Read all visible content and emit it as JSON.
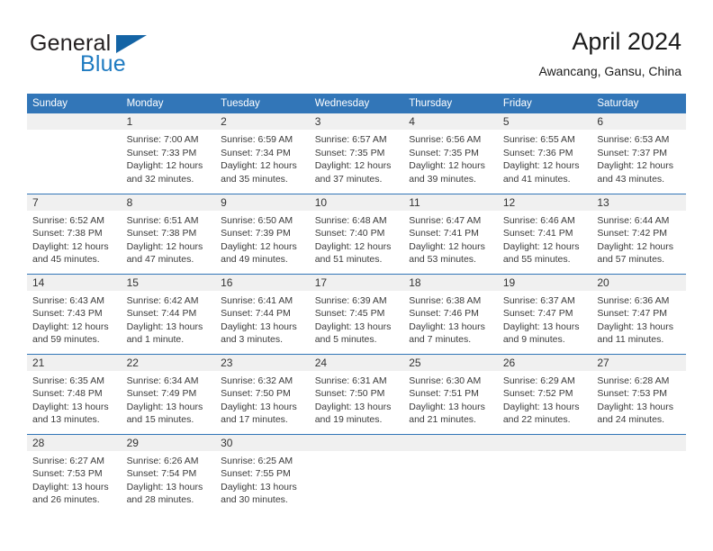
{
  "brand": {
    "name_part1": "General",
    "name_part2": "Blue",
    "flag_icon": "triangle-flag-icon"
  },
  "header": {
    "title": "April 2024",
    "subtitle": "Awancang, Gansu, China"
  },
  "colors": {
    "header_blue": "#3276b8",
    "brand_blue": "#1f7bc1",
    "flag_blue": "#1464a5",
    "daynum_band": "#f0f0f0",
    "body_text": "#3a3a3a"
  },
  "weekdays": [
    "Sunday",
    "Monday",
    "Tuesday",
    "Wednesday",
    "Thursday",
    "Friday",
    "Saturday"
  ],
  "weeks": [
    [
      {
        "day": "",
        "lines": []
      },
      {
        "day": "1",
        "lines": [
          "Sunrise: 7:00 AM",
          "Sunset: 7:33 PM",
          "Daylight: 12 hours",
          "and 32 minutes."
        ]
      },
      {
        "day": "2",
        "lines": [
          "Sunrise: 6:59 AM",
          "Sunset: 7:34 PM",
          "Daylight: 12 hours",
          "and 35 minutes."
        ]
      },
      {
        "day": "3",
        "lines": [
          "Sunrise: 6:57 AM",
          "Sunset: 7:35 PM",
          "Daylight: 12 hours",
          "and 37 minutes."
        ]
      },
      {
        "day": "4",
        "lines": [
          "Sunrise: 6:56 AM",
          "Sunset: 7:35 PM",
          "Daylight: 12 hours",
          "and 39 minutes."
        ]
      },
      {
        "day": "5",
        "lines": [
          "Sunrise: 6:55 AM",
          "Sunset: 7:36 PM",
          "Daylight: 12 hours",
          "and 41 minutes."
        ]
      },
      {
        "day": "6",
        "lines": [
          "Sunrise: 6:53 AM",
          "Sunset: 7:37 PM",
          "Daylight: 12 hours",
          "and 43 minutes."
        ]
      }
    ],
    [
      {
        "day": "7",
        "lines": [
          "Sunrise: 6:52 AM",
          "Sunset: 7:38 PM",
          "Daylight: 12 hours",
          "and 45 minutes."
        ]
      },
      {
        "day": "8",
        "lines": [
          "Sunrise: 6:51 AM",
          "Sunset: 7:38 PM",
          "Daylight: 12 hours",
          "and 47 minutes."
        ]
      },
      {
        "day": "9",
        "lines": [
          "Sunrise: 6:50 AM",
          "Sunset: 7:39 PM",
          "Daylight: 12 hours",
          "and 49 minutes."
        ]
      },
      {
        "day": "10",
        "lines": [
          "Sunrise: 6:48 AM",
          "Sunset: 7:40 PM",
          "Daylight: 12 hours",
          "and 51 minutes."
        ]
      },
      {
        "day": "11",
        "lines": [
          "Sunrise: 6:47 AM",
          "Sunset: 7:41 PM",
          "Daylight: 12 hours",
          "and 53 minutes."
        ]
      },
      {
        "day": "12",
        "lines": [
          "Sunrise: 6:46 AM",
          "Sunset: 7:41 PM",
          "Daylight: 12 hours",
          "and 55 minutes."
        ]
      },
      {
        "day": "13",
        "lines": [
          "Sunrise: 6:44 AM",
          "Sunset: 7:42 PM",
          "Daylight: 12 hours",
          "and 57 minutes."
        ]
      }
    ],
    [
      {
        "day": "14",
        "lines": [
          "Sunrise: 6:43 AM",
          "Sunset: 7:43 PM",
          "Daylight: 12 hours",
          "and 59 minutes."
        ]
      },
      {
        "day": "15",
        "lines": [
          "Sunrise: 6:42 AM",
          "Sunset: 7:44 PM",
          "Daylight: 13 hours",
          "and 1 minute."
        ]
      },
      {
        "day": "16",
        "lines": [
          "Sunrise: 6:41 AM",
          "Sunset: 7:44 PM",
          "Daylight: 13 hours",
          "and 3 minutes."
        ]
      },
      {
        "day": "17",
        "lines": [
          "Sunrise: 6:39 AM",
          "Sunset: 7:45 PM",
          "Daylight: 13 hours",
          "and 5 minutes."
        ]
      },
      {
        "day": "18",
        "lines": [
          "Sunrise: 6:38 AM",
          "Sunset: 7:46 PM",
          "Daylight: 13 hours",
          "and 7 minutes."
        ]
      },
      {
        "day": "19",
        "lines": [
          "Sunrise: 6:37 AM",
          "Sunset: 7:47 PM",
          "Daylight: 13 hours",
          "and 9 minutes."
        ]
      },
      {
        "day": "20",
        "lines": [
          "Sunrise: 6:36 AM",
          "Sunset: 7:47 PM",
          "Daylight: 13 hours",
          "and 11 minutes."
        ]
      }
    ],
    [
      {
        "day": "21",
        "lines": [
          "Sunrise: 6:35 AM",
          "Sunset: 7:48 PM",
          "Daylight: 13 hours",
          "and 13 minutes."
        ]
      },
      {
        "day": "22",
        "lines": [
          "Sunrise: 6:34 AM",
          "Sunset: 7:49 PM",
          "Daylight: 13 hours",
          "and 15 minutes."
        ]
      },
      {
        "day": "23",
        "lines": [
          "Sunrise: 6:32 AM",
          "Sunset: 7:50 PM",
          "Daylight: 13 hours",
          "and 17 minutes."
        ]
      },
      {
        "day": "24",
        "lines": [
          "Sunrise: 6:31 AM",
          "Sunset: 7:50 PM",
          "Daylight: 13 hours",
          "and 19 minutes."
        ]
      },
      {
        "day": "25",
        "lines": [
          "Sunrise: 6:30 AM",
          "Sunset: 7:51 PM",
          "Daylight: 13 hours",
          "and 21 minutes."
        ]
      },
      {
        "day": "26",
        "lines": [
          "Sunrise: 6:29 AM",
          "Sunset: 7:52 PM",
          "Daylight: 13 hours",
          "and 22 minutes."
        ]
      },
      {
        "day": "27",
        "lines": [
          "Sunrise: 6:28 AM",
          "Sunset: 7:53 PM",
          "Daylight: 13 hours",
          "and 24 minutes."
        ]
      }
    ],
    [
      {
        "day": "28",
        "lines": [
          "Sunrise: 6:27 AM",
          "Sunset: 7:53 PM",
          "Daylight: 13 hours",
          "and 26 minutes."
        ]
      },
      {
        "day": "29",
        "lines": [
          "Sunrise: 6:26 AM",
          "Sunset: 7:54 PM",
          "Daylight: 13 hours",
          "and 28 minutes."
        ]
      },
      {
        "day": "30",
        "lines": [
          "Sunrise: 6:25 AM",
          "Sunset: 7:55 PM",
          "Daylight: 13 hours",
          "and 30 minutes."
        ]
      },
      {
        "day": "",
        "lines": []
      },
      {
        "day": "",
        "lines": []
      },
      {
        "day": "",
        "lines": []
      },
      {
        "day": "",
        "lines": []
      }
    ]
  ]
}
